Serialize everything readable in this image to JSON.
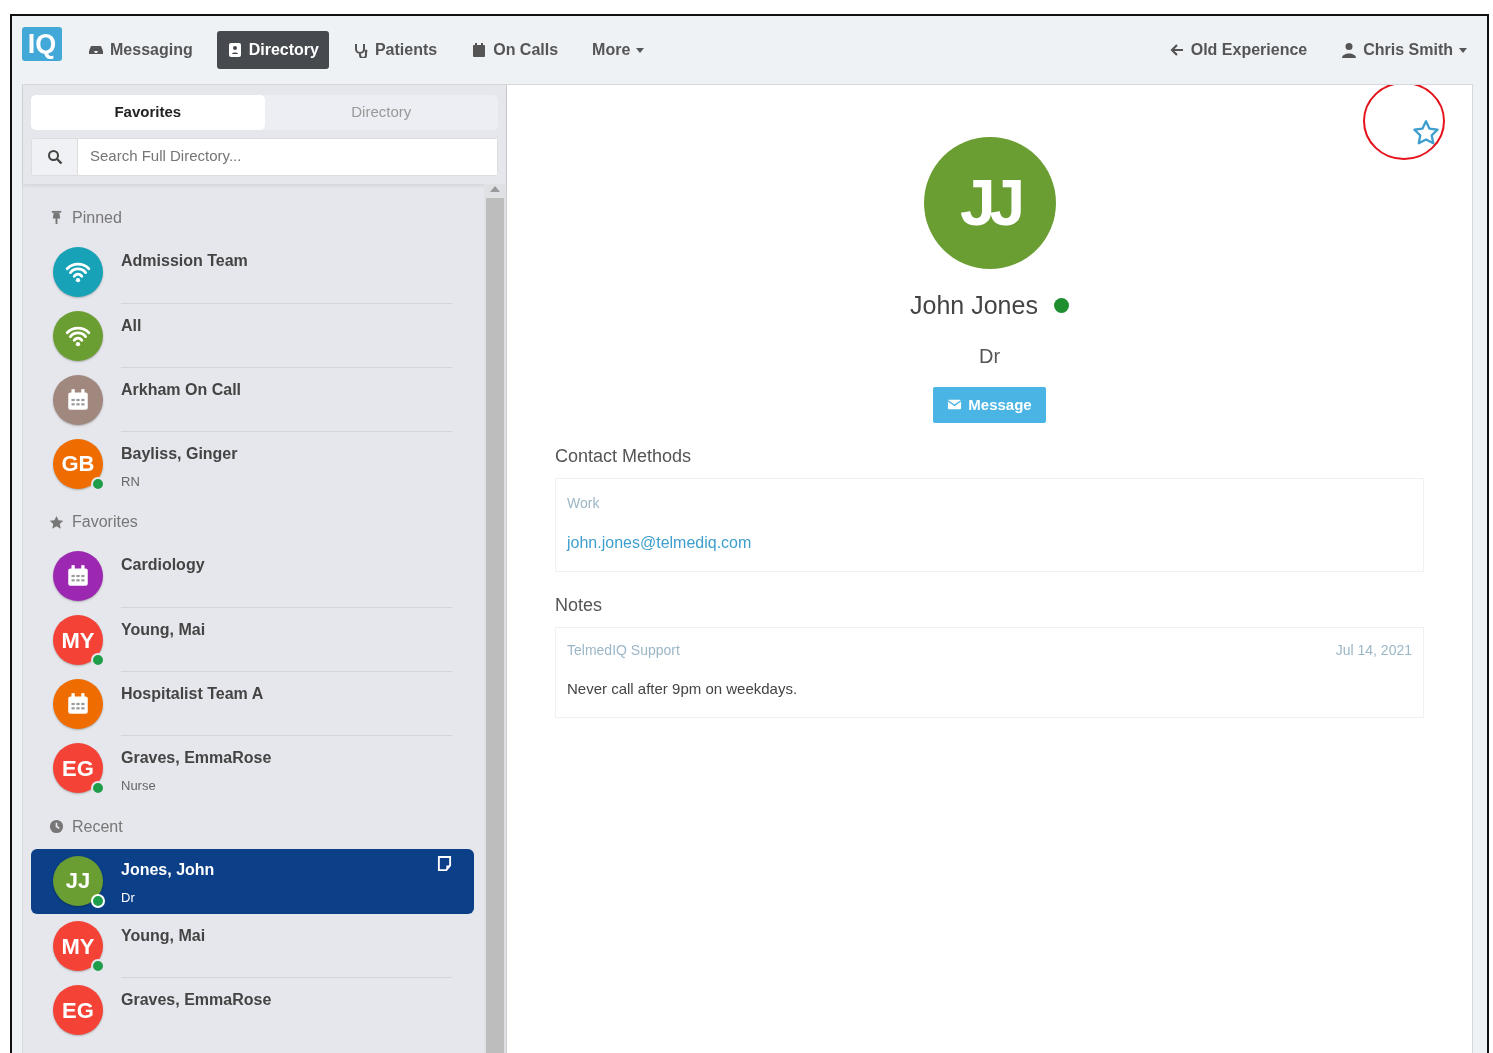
{
  "navbar": {
    "logo": "IQ",
    "items": [
      {
        "label": "Messaging",
        "selected": false
      },
      {
        "label": "Directory",
        "selected": true
      },
      {
        "label": "Patients",
        "selected": false
      },
      {
        "label": "On Calls",
        "selected": false
      },
      {
        "label": "More",
        "selected": false,
        "dropdown": true
      }
    ],
    "right": [
      {
        "label": "Old Experience"
      },
      {
        "label": "Chris Smith",
        "dropdown": true
      }
    ]
  },
  "sidebar": {
    "tabs": [
      {
        "label": "Favorites",
        "selected": true
      },
      {
        "label": "Directory",
        "selected": false
      }
    ],
    "search": {
      "placeholder": "Search Full Directory..."
    },
    "sections": [
      {
        "title": "Pinned",
        "items": [
          {
            "name": "Admission Team",
            "avatar": {
              "kind": "wifi",
              "color": "#17a2b8"
            },
            "selected": false
          },
          {
            "name": "All",
            "avatar": {
              "kind": "wifi",
              "color": "#6b9e32"
            },
            "selected": false
          },
          {
            "name": "Arkham On Call",
            "avatar": {
              "kind": "calendar",
              "color": "#a0887e"
            },
            "selected": false
          },
          {
            "name": "Bayliss, Ginger",
            "subtitle": "RN",
            "avatar": {
              "kind": "initials",
              "text": "GB",
              "color": "#ef6c00"
            },
            "online": true,
            "selected": false
          }
        ]
      },
      {
        "title": "Favorites",
        "items": [
          {
            "name": "Cardiology",
            "avatar": {
              "kind": "calendar",
              "color": "#9c27b0"
            },
            "selected": false
          },
          {
            "name": "Young, Mai",
            "avatar": {
              "kind": "initials",
              "text": "MY",
              "color": "#f44336"
            },
            "online": true,
            "selected": false
          },
          {
            "name": "Hospitalist Team A",
            "avatar": {
              "kind": "calendar",
              "color": "#ef6c00"
            },
            "selected": false
          },
          {
            "name": "Graves, EmmaRose",
            "subtitle": "Nurse",
            "avatar": {
              "kind": "initials",
              "text": "EG",
              "color": "#f44336"
            },
            "online": true,
            "selected": false
          }
        ]
      },
      {
        "title": "Recent",
        "items": [
          {
            "name": "Jones, John",
            "subtitle": "Dr",
            "avatar": {
              "kind": "initials",
              "text": "JJ",
              "color": "#6b9e32"
            },
            "online": true,
            "selected": true,
            "note": true
          },
          {
            "name": "Young, Mai",
            "avatar": {
              "kind": "initials",
              "text": "MY",
              "color": "#f44336"
            },
            "online": true,
            "selected": false
          },
          {
            "name": "Graves, EmmaRose",
            "avatar": {
              "kind": "initials",
              "text": "EG",
              "color": "#f44336"
            },
            "selected": false
          }
        ]
      }
    ]
  },
  "profile": {
    "favorited": false,
    "favorite_highlighted": true,
    "avatar": {
      "text": "JJ",
      "color": "#6b9e32"
    },
    "name": "John Jones",
    "online": true,
    "title": "Dr",
    "message_button": "Message",
    "contact_methods": {
      "title": "Contact Methods",
      "items": [
        {
          "label": "Work",
          "value": "john.jones@telmediq.com"
        }
      ]
    },
    "notes": {
      "title": "Notes",
      "items": [
        {
          "author": "TelmedIQ Support",
          "date": "Jul 14, 2021",
          "text": "Never call after 9pm on weekdays."
        }
      ]
    }
  }
}
